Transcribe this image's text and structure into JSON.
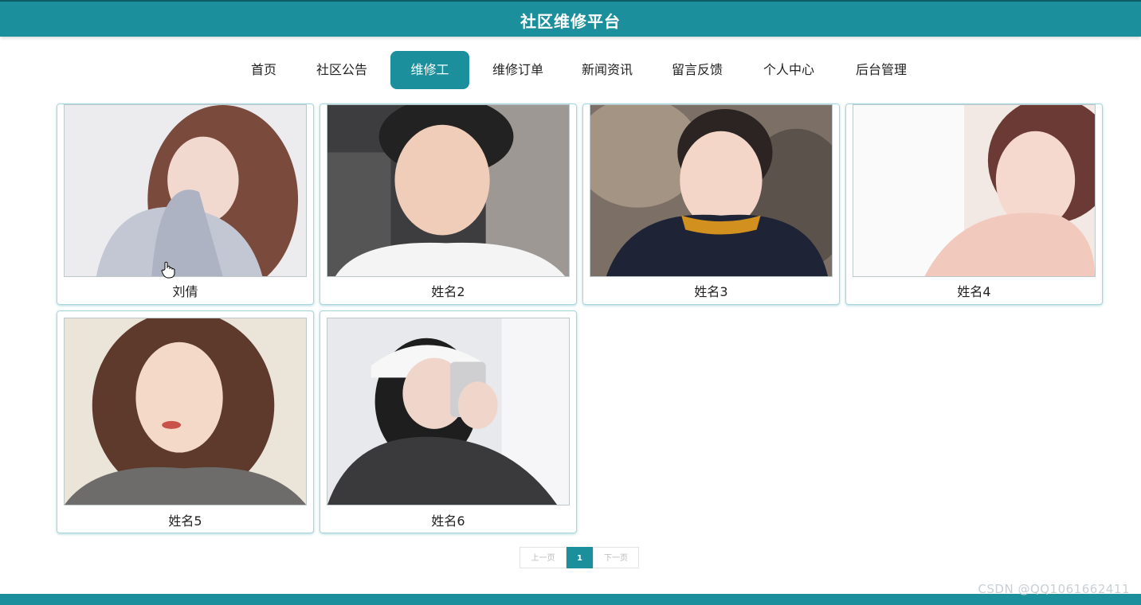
{
  "header": {
    "title": "社区维修平台"
  },
  "nav": {
    "items": [
      {
        "label": "首页"
      },
      {
        "label": "社区公告"
      },
      {
        "label": "维修工",
        "active": true
      },
      {
        "label": "维修订单"
      },
      {
        "label": "新闻资讯"
      },
      {
        "label": "留言反馈"
      },
      {
        "label": "个人中心"
      },
      {
        "label": "后台管理"
      }
    ]
  },
  "workers": [
    {
      "name": "刘倩"
    },
    {
      "name": "姓名2"
    },
    {
      "name": "姓名3"
    },
    {
      "name": "姓名4"
    },
    {
      "name": "姓名5"
    },
    {
      "name": "姓名6"
    }
  ],
  "pagination": {
    "prev": "上一页",
    "current": "1",
    "next": "下一页"
  },
  "watermark": "CSDN @QQ1061662411",
  "colors": {
    "accent": "#1b8f9c"
  }
}
